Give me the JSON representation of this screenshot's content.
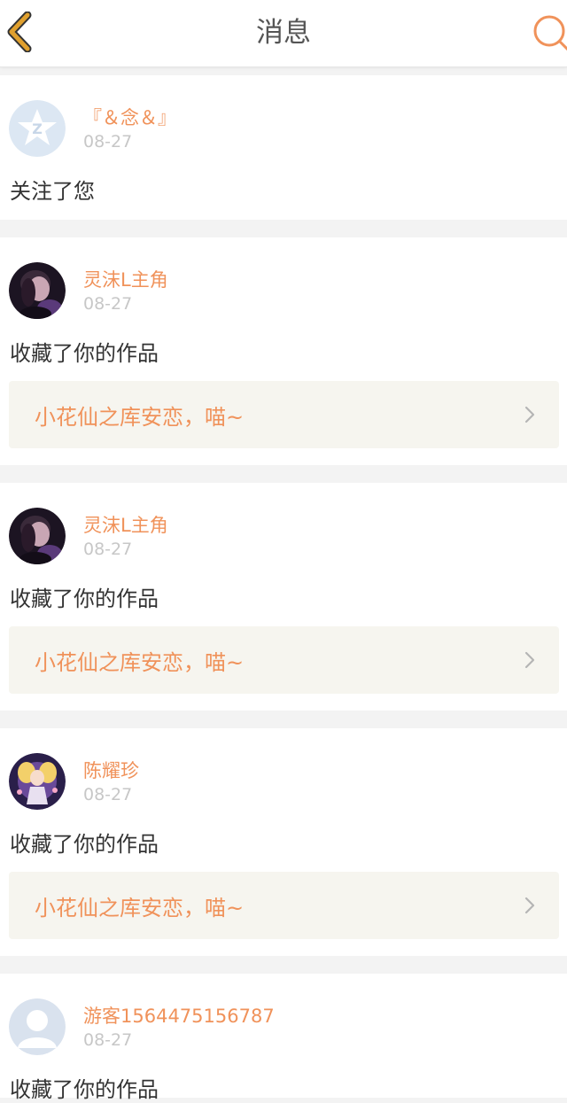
{
  "header": {
    "title": "消息"
  },
  "messages": [
    {
      "user": "『＆念＆』",
      "date": "08-27",
      "action": "关注了您",
      "avatar": "qzone-default-avatar"
    },
    {
      "user": "灵沫L主角",
      "date": "08-27",
      "action": "收藏了你的作品",
      "work_title": "小花仙之库安恋，喵~",
      "avatar": "dark-portrait-avatar"
    },
    {
      "user": "灵沫L主角",
      "date": "08-27",
      "action": "收藏了你的作品",
      "work_title": "小花仙之库安恋，喵~",
      "avatar": "dark-portrait-avatar"
    },
    {
      "user": "陈耀珍",
      "date": "08-27",
      "action": "收藏了你的作品",
      "work_title": "小花仙之库安恋，喵~",
      "avatar": "anime-character-avatar"
    },
    {
      "user": "游客1564475156787",
      "date": "08-27",
      "action": "收藏了你的作品",
      "avatar": "guest-default-avatar"
    }
  ],
  "colors": {
    "accent": "#f0925a",
    "back_icon": "#e0a02e",
    "link_bg": "#f6f5ef"
  }
}
